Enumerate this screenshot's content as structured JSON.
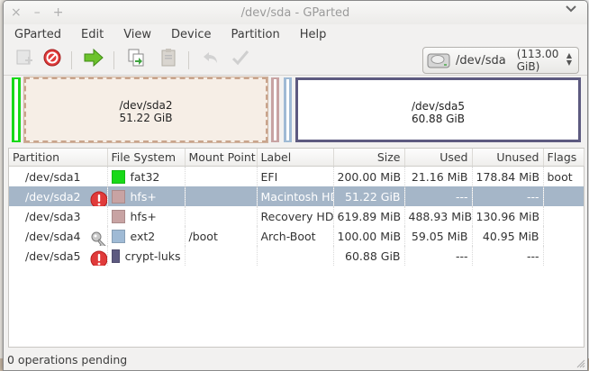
{
  "window": {
    "title": "/dev/sda - GParted",
    "titlebar_buttons": [
      "×",
      "–",
      "+"
    ]
  },
  "menu": [
    "GParted",
    "Edit",
    "View",
    "Device",
    "Partition",
    "Help"
  ],
  "toolbar": {
    "icons": [
      "new-partition-icon",
      "delete-icon",
      "apply-icon",
      "copy-icon",
      "paste-icon",
      "undo-icon",
      "check-icon"
    ]
  },
  "device_selector": {
    "device": "/dev/sda",
    "size": "(113.00 GiB)"
  },
  "diskmap": [
    {
      "name": "/dev/sda2",
      "size": "51.22 GiB"
    },
    {
      "name": "/dev/sda5",
      "size": "60.88 GiB"
    }
  ],
  "table": {
    "headers": [
      "Partition",
      "File System",
      "Mount Point",
      "Label",
      "Size",
      "Used",
      "Unused",
      "Flags"
    ],
    "rows": [
      {
        "partition": "/dev/sda1",
        "icon": "",
        "fs": "fat32",
        "fs_color": "#18d918",
        "mount": "",
        "label": "EFI",
        "size": "200.00 MiB",
        "used": "21.16 MiB",
        "unused": "178.84 MiB",
        "flags": "boot",
        "selected": false
      },
      {
        "partition": "/dev/sda2",
        "icon": "error",
        "fs": "hfs+",
        "fs_color": "#c8a3a3",
        "mount": "",
        "label": "Macintosh HD",
        "size": "51.22 GiB",
        "used": "---",
        "unused": "---",
        "flags": "",
        "selected": true
      },
      {
        "partition": "/dev/sda3",
        "icon": "",
        "fs": "hfs+",
        "fs_color": "#c8a3a3",
        "mount": "",
        "label": "Recovery HD",
        "size": "619.89 MiB",
        "used": "488.93 MiB",
        "unused": "130.96 MiB",
        "flags": "",
        "selected": false
      },
      {
        "partition": "/dev/sda4",
        "icon": "key",
        "fs": "ext2",
        "fs_color": "#9fbad5",
        "mount": "/boot",
        "label": "Arch-Boot",
        "size": "100.00 MiB",
        "used": "59.05 MiB",
        "unused": "40.95 MiB",
        "flags": "",
        "selected": false
      },
      {
        "partition": "/dev/sda5",
        "icon": "error",
        "fs": "crypt-luks",
        "fs_color": "#5d5a80",
        "mount": "",
        "label": "",
        "size": "60.88 GiB",
        "used": "---",
        "unused": "---",
        "flags": "",
        "selected": false
      }
    ]
  },
  "status": {
    "text": "0 operations pending"
  },
  "colors": {
    "selection": "#a5b6c8",
    "efi": "#18d918",
    "hfs": "#c8a3a3",
    "ext2": "#9fbad5",
    "luks": "#5d5a80",
    "error": "#e03b3b"
  }
}
